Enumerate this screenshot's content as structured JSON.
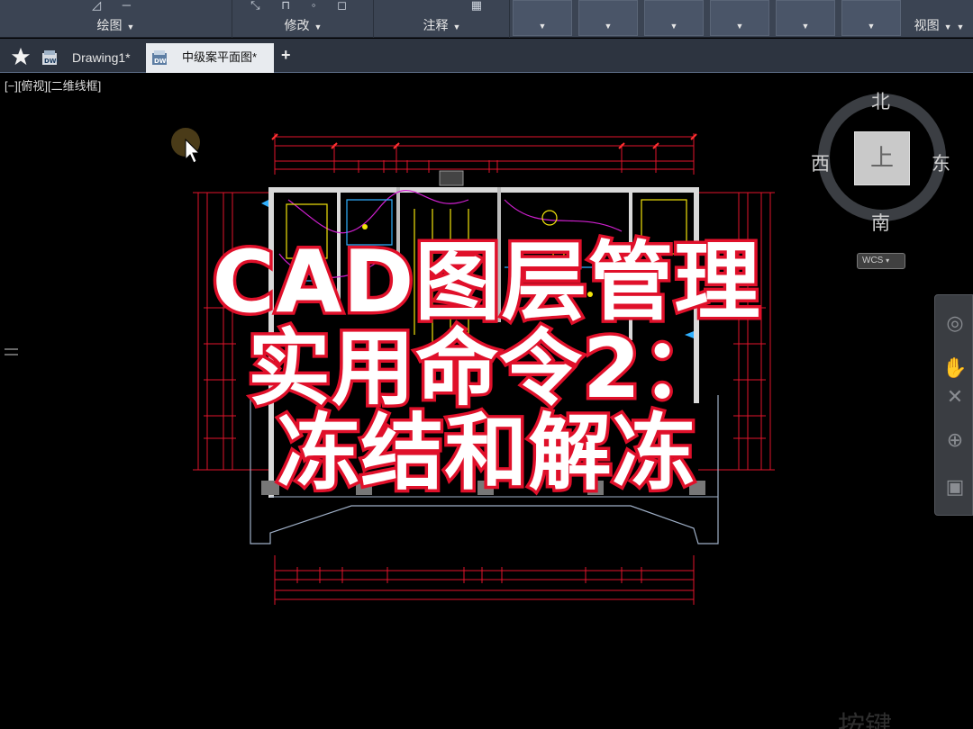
{
  "ribbon": {
    "panels": [
      {
        "label": "绘图"
      },
      {
        "label": "修改"
      },
      {
        "label": "注释"
      },
      {
        "label": "视图"
      }
    ]
  },
  "tabs": [
    {
      "label": "Drawing1*"
    },
    {
      "label": "中级案平面图*"
    }
  ],
  "viewport": {
    "label": "[−][俯视][二维线框]"
  },
  "viewcube": {
    "north": "北",
    "south": "南",
    "east": "东",
    "west": "西",
    "face": "上",
    "wcs": "WCS"
  },
  "overlay": {
    "line1": "CAD图层管理",
    "line2": "实用命令2：",
    "line3": "冻结和解冻"
  },
  "watermark": "按键",
  "colors": {
    "ribbon_bg": "#3b4453",
    "tab_bar_bg": "#2d3440",
    "active_tab_bg": "#e8ebef",
    "overlay_outline": "#e0102a",
    "dimension_red": "#e2142b",
    "wall_white": "#e6e6e6",
    "viewport_bg": "#000000"
  }
}
